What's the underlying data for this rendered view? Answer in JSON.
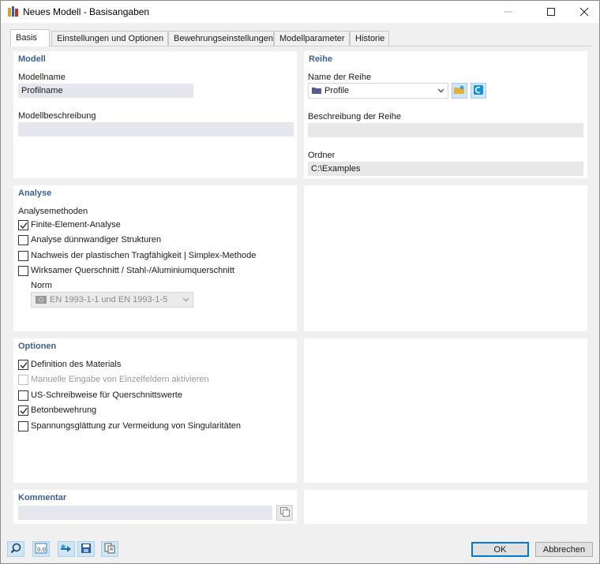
{
  "window": {
    "title": "Neues Modell - Basisangaben"
  },
  "tabs": [
    {
      "label": "Basis"
    },
    {
      "label": "Einstellungen und Optionen"
    },
    {
      "label": "Bewehrungseinstellungen"
    },
    {
      "label": "Modellparameter"
    },
    {
      "label": "Historie"
    }
  ],
  "modell": {
    "title": "Modell",
    "name_label": "Modellname",
    "name_value": "Profilname",
    "desc_label": "Modellbeschreibung",
    "desc_value": ""
  },
  "reihe": {
    "title": "Reihe",
    "name_label": "Name der Reihe",
    "name_value": "Profile",
    "desc_label": "Beschreibung der Reihe",
    "desc_value": "",
    "folder_label": "Ordner",
    "folder_value": "C:\\Examples"
  },
  "analyse": {
    "title": "Analyse",
    "methods_label": "Analysemethoden",
    "options": [
      {
        "label": "Finite-Element-Analyse",
        "checked": true
      },
      {
        "label": "Analyse dünnwandiger Strukturen",
        "checked": false
      },
      {
        "label": "Nachweis der plastischen Tragfähigkeit | Simplex-Methode",
        "checked": false
      },
      {
        "label": "Wirksamer Querschnitt / Stahl-/Aluminiumquerschnitt",
        "checked": false
      }
    ],
    "norm_label": "Norm",
    "norm_value": "EN 1993-1-1 und EN 1993-1-5"
  },
  "optionen": {
    "title": "Optionen",
    "options": [
      {
        "label": "Definition des Materials",
        "checked": true,
        "disabled": false
      },
      {
        "label": "Manuelle Eingabe von Einzelfeldern aktivieren",
        "checked": false,
        "disabled": true
      },
      {
        "label": "US-Schreibweise für Querschnittswerte",
        "checked": false,
        "disabled": false
      },
      {
        "label": "Betonbewehrung",
        "checked": true,
        "disabled": false
      },
      {
        "label": "Spannungsglättung zur Vermeidung von Singularitäten",
        "checked": false,
        "disabled": false
      }
    ]
  },
  "kommentar": {
    "title": "Kommentar",
    "value": ""
  },
  "buttons": {
    "ok": "OK",
    "cancel": "Abbrechen"
  },
  "colors": {
    "accent": "#0078d7",
    "section_title": "#3f5f8f",
    "field_bg": "#e6e6ee"
  }
}
